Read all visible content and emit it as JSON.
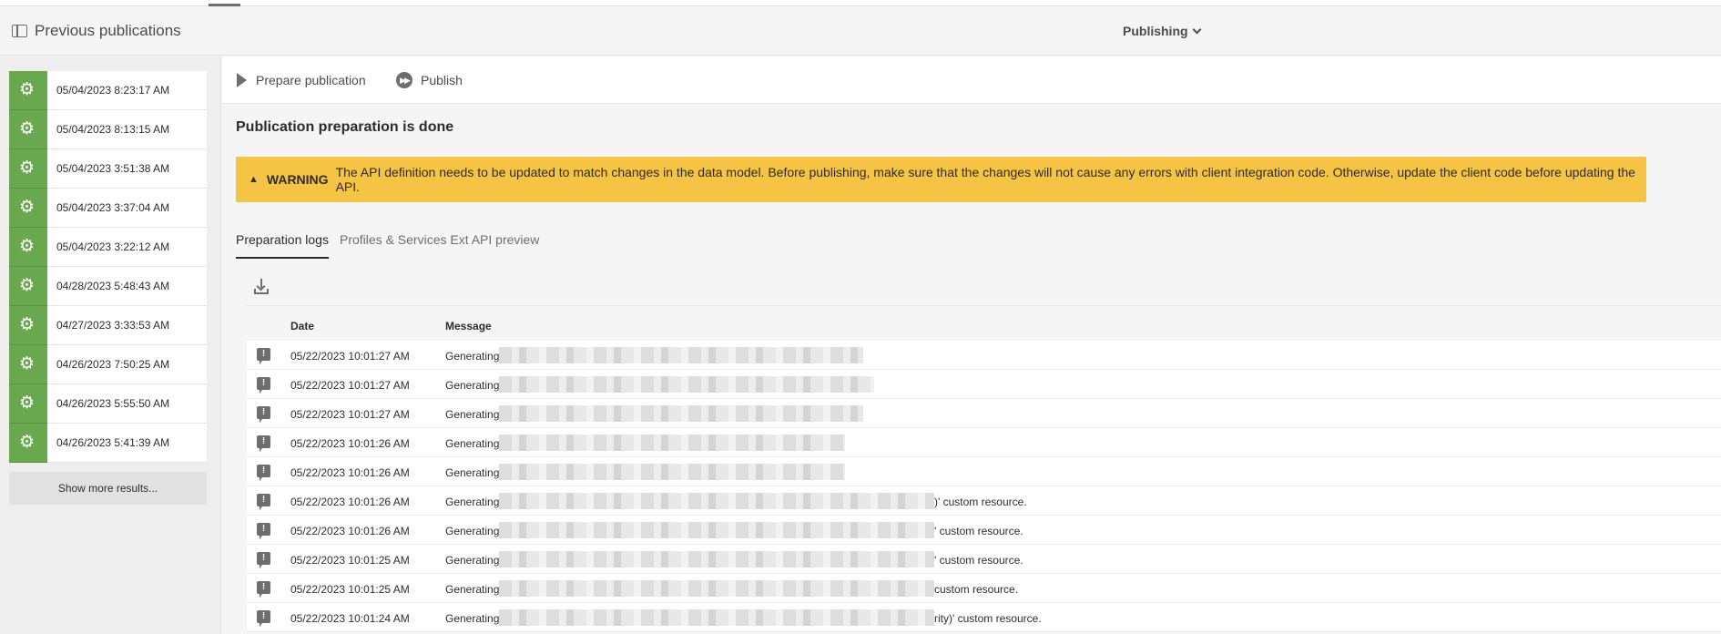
{
  "header": {
    "title": "Previous publications",
    "menu_label": "Publishing"
  },
  "sidebar": {
    "items": [
      {
        "label": "05/04/2023 8:23:17 AM"
      },
      {
        "label": "05/04/2023 8:13:15 AM"
      },
      {
        "label": "05/04/2023 3:51:38 AM"
      },
      {
        "label": "05/04/2023 3:37:04 AM"
      },
      {
        "label": "05/04/2023 3:22:12 AM"
      },
      {
        "label": "04/28/2023 5:48:43 AM"
      },
      {
        "label": "04/27/2023 3:33:53 AM"
      },
      {
        "label": "04/26/2023 7:50:25 AM"
      },
      {
        "label": "04/26/2023 5:55:50 AM"
      },
      {
        "label": "04/26/2023 5:41:39 AM"
      }
    ],
    "show_more_label": "Show more results..."
  },
  "toolbar": {
    "prepare_label": "Prepare publication",
    "publish_label": "Publish"
  },
  "main": {
    "heading": "Publication preparation is done",
    "warning": {
      "label": "WARNING",
      "text": "The API definition needs to be updated to match changes in the data model. Before publishing, make sure that the changes will not cause any errors with client integration code. Otherwise, update the client code before updating the API.",
      "color": "#f5c444"
    },
    "tabs": [
      {
        "label": "Preparation logs",
        "active": true
      },
      {
        "label": "Profiles & Services Ext API preview",
        "active": false
      }
    ]
  },
  "logs": {
    "columns": [
      "Date",
      "Message"
    ],
    "rows": [
      {
        "date": "05/22/2023 10:01:27 AM",
        "message": "Generating",
        "tail": ""
      },
      {
        "date": "05/22/2023 10:01:27 AM",
        "message": "Generating",
        "tail": ""
      },
      {
        "date": "05/22/2023 10:01:27 AM",
        "message": "Generating",
        "tail": ""
      },
      {
        "date": "05/22/2023 10:01:26 AM",
        "message": "Generating",
        "tail": ""
      },
      {
        "date": "05/22/2023 10:01:26 AM",
        "message": "Generating",
        "tail": ""
      },
      {
        "date": "05/22/2023 10:01:26 AM",
        "message": "Generating",
        "tail": ")' custom resource."
      },
      {
        "date": "05/22/2023 10:01:26 AM",
        "message": "Generating",
        "tail": "' custom resource."
      },
      {
        "date": "05/22/2023 10:01:25 AM",
        "message": "Generating",
        "tail": "' custom resource."
      },
      {
        "date": "05/22/2023 10:01:25 AM",
        "message": "Generating",
        "tail": "custom resource."
      },
      {
        "date": "05/22/2023 10:01:24 AM",
        "message": "Generating",
        "tail": "rity)' custom resource."
      }
    ]
  },
  "colors": {
    "accent_green": "#6aa84f",
    "warning_yellow": "#f5c444"
  }
}
